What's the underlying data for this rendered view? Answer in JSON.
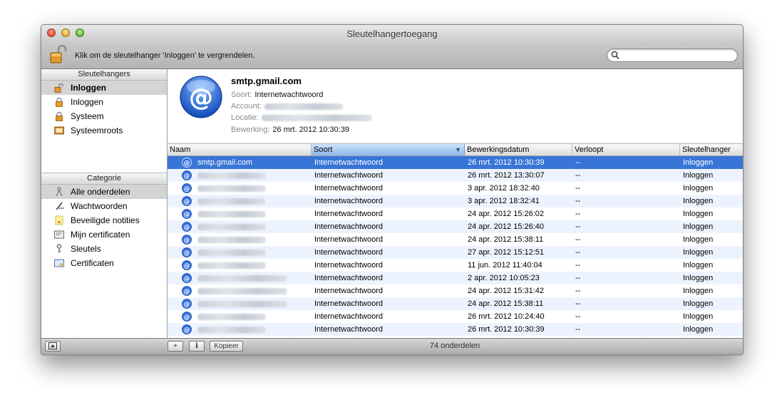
{
  "window": {
    "title": "Sleutelhangertoegang"
  },
  "toolbar": {
    "lock_text": "Klik om de sleutelhanger 'Inloggen' te vergrendelen.",
    "search_placeholder": ""
  },
  "sidebar": {
    "keychains_header": "Sleutelhangers",
    "keychains": [
      {
        "label": "Inloggen",
        "icon": "unlocked-padlock-icon",
        "selected": true
      },
      {
        "label": "Inloggen",
        "icon": "padlock-icon",
        "selected": false
      },
      {
        "label": "Systeem",
        "icon": "padlock-icon",
        "selected": false
      },
      {
        "label": "Systeemroots",
        "icon": "certificate-folder-icon",
        "selected": false
      }
    ],
    "category_header": "Categorie",
    "categories": [
      {
        "label": "Alle onderdelen",
        "icon": "all-items-icon",
        "selected": true
      },
      {
        "label": "Wachtwoorden",
        "icon": "password-pen-icon",
        "selected": false
      },
      {
        "label": "Beveiligde notities",
        "icon": "secure-note-icon",
        "selected": false
      },
      {
        "label": "Mijn certificaten",
        "icon": "my-certificate-icon",
        "selected": false
      },
      {
        "label": "Sleutels",
        "icon": "key-icon",
        "selected": false
      },
      {
        "label": "Certificaten",
        "icon": "certificate-icon",
        "selected": false
      }
    ]
  },
  "detail": {
    "name": "smtp.gmail.com",
    "kind_label": "Soort:",
    "kind_value": "Internetwachtwoord",
    "account_label": "Account:",
    "location_label": "Locatie:",
    "modified_label": "Bewerking:",
    "modified_value": "26 mrt. 2012 10:30:39"
  },
  "table": {
    "columns": [
      "Naam",
      "Soort",
      "Bewerkingsdatum",
      "Verloopt",
      "Sleutelhanger"
    ],
    "sorted_column": "Soort",
    "rows": [
      {
        "name": "smtp.gmail.com",
        "kind": "Internetwachtwoord",
        "date": "26 mrt. 2012 10:30:39",
        "expires": "--",
        "keychain": "Inloggen",
        "selected": true
      },
      {
        "name": "",
        "kind": "Internetwachtwoord",
        "date": "26 mrt. 2012 13:30:07",
        "expires": "--",
        "keychain": "Inloggen"
      },
      {
        "name": "",
        "kind": "Internetwachtwoord",
        "date": "3 apr. 2012 18:32:40",
        "expires": "--",
        "keychain": "Inloggen"
      },
      {
        "name": "",
        "kind": "Internetwachtwoord",
        "date": "3 apr. 2012 18:32:41",
        "expires": "--",
        "keychain": "Inloggen"
      },
      {
        "name": "",
        "kind": "Internetwachtwoord",
        "date": "24 apr. 2012 15:26:02",
        "expires": "--",
        "keychain": "Inloggen"
      },
      {
        "name": "",
        "kind": "Internetwachtwoord",
        "date": "24 apr. 2012 15:26:40",
        "expires": "--",
        "keychain": "Inloggen"
      },
      {
        "name": "",
        "kind": "Internetwachtwoord",
        "date": "24 apr. 2012 15:38:11",
        "expires": "--",
        "keychain": "Inloggen"
      },
      {
        "name": "",
        "kind": "Internetwachtwoord",
        "date": "27 apr. 2012 15:12:51",
        "expires": "--",
        "keychain": "Inloggen"
      },
      {
        "name": "",
        "kind": "Internetwachtwoord",
        "date": "11 jun. 2012 11:40:04",
        "expires": "--",
        "keychain": "Inloggen"
      },
      {
        "name": "",
        "kind": "Internetwachtwoord",
        "date": "2 apr. 2012 10:05:23",
        "expires": "--",
        "keychain": "Inloggen"
      },
      {
        "name": "",
        "kind": "Internetwachtwoord",
        "date": "24 apr. 2012 15:31:42",
        "expires": "--",
        "keychain": "Inloggen"
      },
      {
        "name": "",
        "kind": "Internetwachtwoord",
        "date": "24 apr. 2012 15:38:11",
        "expires": "--",
        "keychain": "Inloggen"
      },
      {
        "name": "",
        "kind": "Internetwachtwoord",
        "date": "26 mrt. 2012 10:24:40",
        "expires": "--",
        "keychain": "Inloggen"
      },
      {
        "name": "",
        "kind": "Internetwachtwoord",
        "date": "26 mrt. 2012 10:30:39",
        "expires": "--",
        "keychain": "Inloggen"
      }
    ]
  },
  "bottom": {
    "copy_label": "Kopieer",
    "info_label": "i",
    "add_label": "+",
    "count_text": "74 onderdelen"
  },
  "colors": {
    "selection": "#3875d7",
    "alt_row": "#edf3fe"
  }
}
